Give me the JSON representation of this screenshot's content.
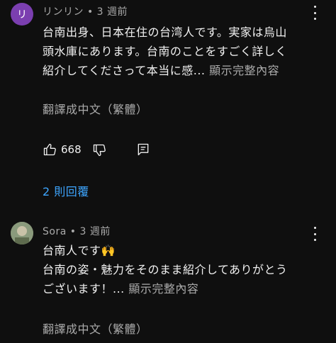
{
  "comments": [
    {
      "avatar_letter": "リ",
      "author": "リンリン",
      "time": "3 週前",
      "lines": [
        "台南出身、日本在住の台湾人です。実家は烏山",
        "頭水庫にあります。台南のことをすごく詳しく",
        "紹介してくださって本当に感..."
      ],
      "show_more": "顯示完整內容",
      "translate": "翻譯成中文（繁體）",
      "like_count": "668",
      "replies": "2 則回覆"
    },
    {
      "author": "Sora",
      "time": "3 週前",
      "lines": [
        "台南人です🙌",
        "台南の姿・魅力をそのまま紹介してありがとう",
        "ございます！..."
      ],
      "show_more": "顯示完整內容",
      "translate": "翻譯成中文（繁體）"
    }
  ],
  "separator": " • "
}
